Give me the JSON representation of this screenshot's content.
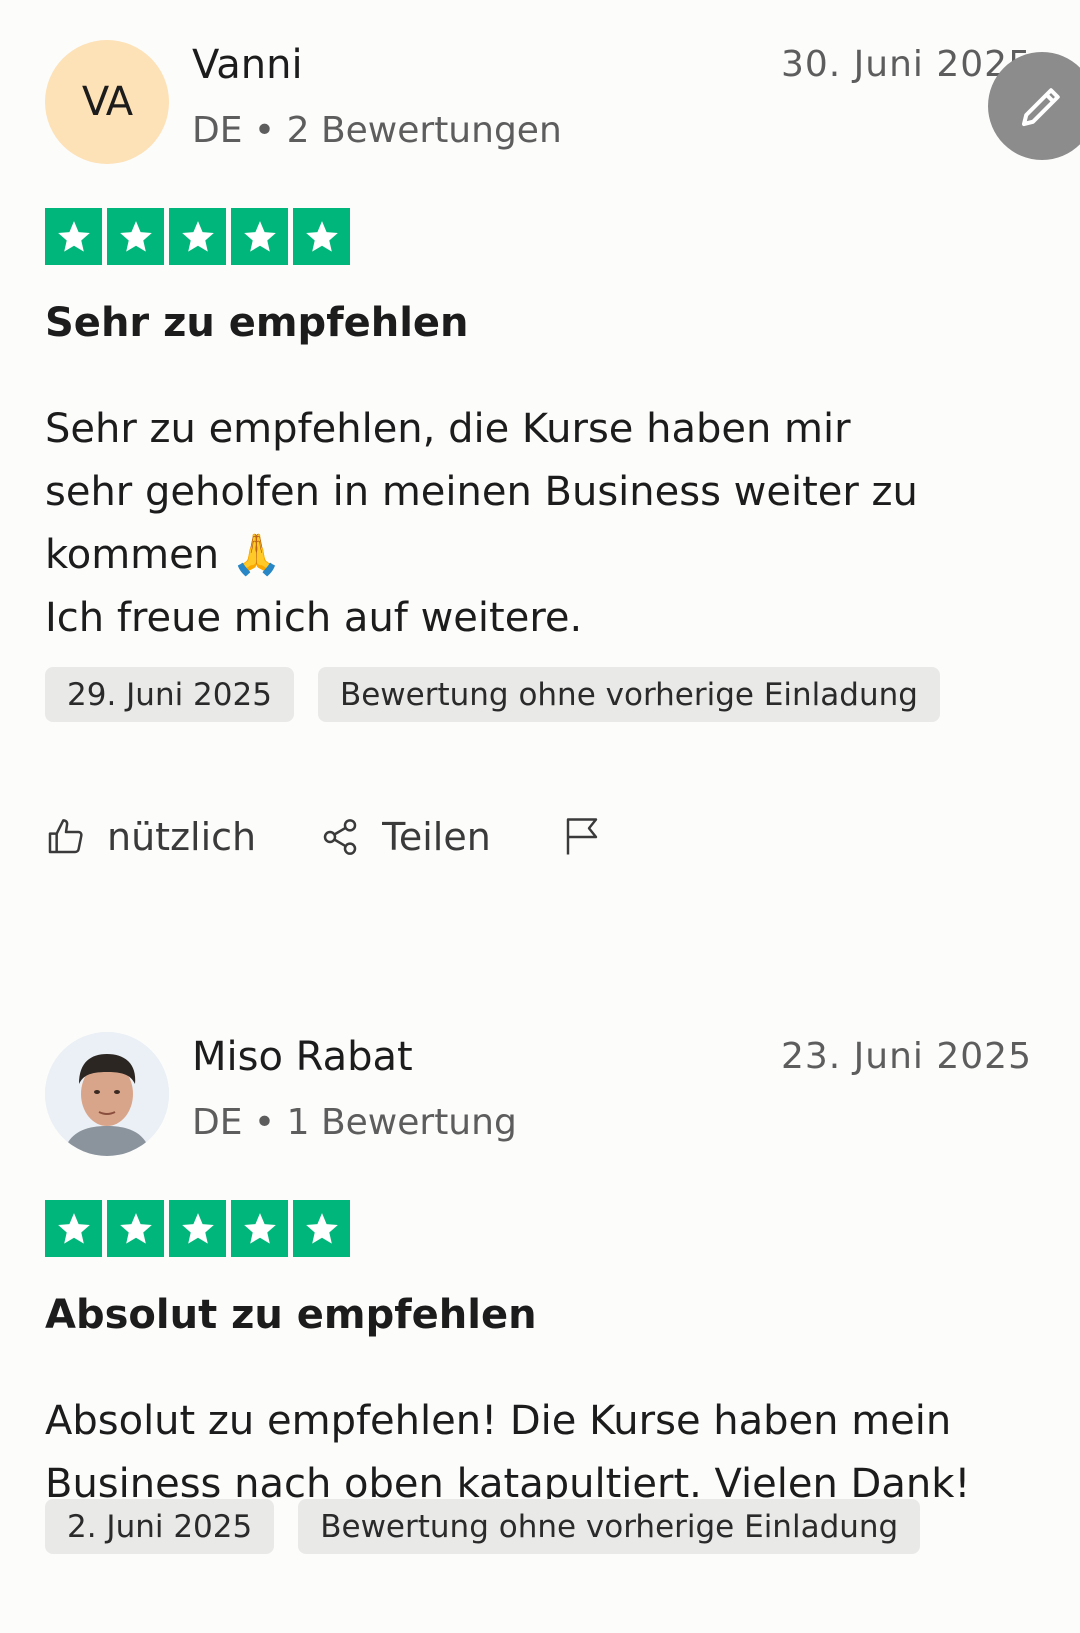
{
  "reviews": [
    {
      "author": "Vanni",
      "initials": "VA",
      "country": "DE",
      "review_count": "2 Bewertungen",
      "date": "30. Juni 2025",
      "rating": 5,
      "title": "Sehr zu empfehlen",
      "body_lines": [
        "Sehr zu empfehlen, die Kurse haben mir",
        "sehr geholfen in meinen Business weiter zu",
        "kommen 🙏",
        "Ich freue mich auf weitere."
      ],
      "experience_date": "29. Juni 2025",
      "tag": "Bewertung ohne vorherige Einladung",
      "useful_label": "nützlich",
      "share_label": "Teilen"
    },
    {
      "author": "Miso Rabat",
      "country": "DE",
      "review_count": "1 Bewertung",
      "date": "23. Juni 2025",
      "rating": 5,
      "title": "Absolut zu empfehlen",
      "body_lines": [
        "Absolut zu empfehlen! Die Kurse haben mein",
        "Business nach oben katapultiert. Vielen Dank!"
      ],
      "experience_date": "2. Juni 2025",
      "tag": "Bewertung ohne vorherige Einladung"
    }
  ],
  "meta_separator": "•",
  "colors": {
    "star_green": "#00b67a",
    "initials_avatar": "#fde1b7",
    "fab": "#8c8c8c",
    "tag_bg": "#e9e9e8"
  },
  "icons": [
    "star-icon",
    "thumbs-up-icon",
    "share-icon",
    "flag-icon",
    "pencil-icon"
  ]
}
